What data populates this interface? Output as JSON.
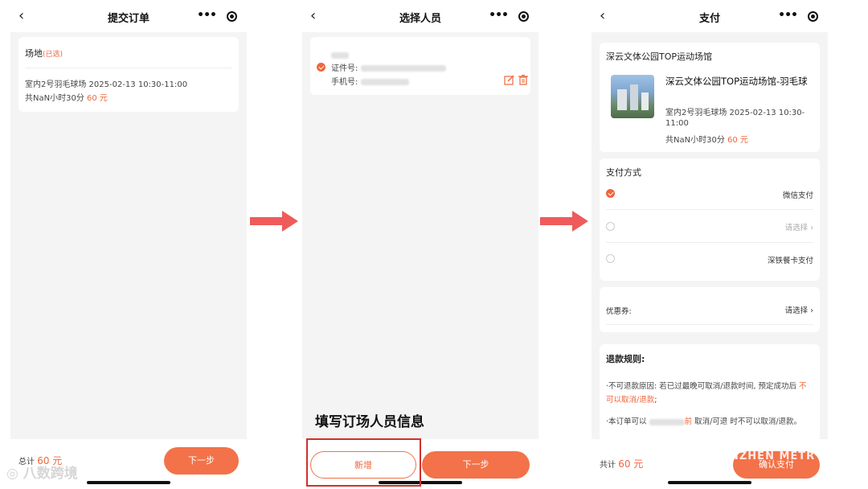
{
  "screen1": {
    "title": "提交订单",
    "venue_label": "场地",
    "venue_selected": "(已选)",
    "booking_line": "室内2号羽毛球场 2025-02-13 10:30-11:00",
    "duration_prefix": "共NaN小时30分",
    "duration_price": "60 元",
    "total_label": "总计",
    "total_price": "60 元",
    "next_button": "下一步"
  },
  "screen2": {
    "title": "选择人员",
    "person_name": "",
    "id_label": "证件号:",
    "phone_label": "手机号:",
    "caption": "填写订场人员信息",
    "add_button": "新增",
    "next_button": "下一步"
  },
  "screen3": {
    "title": "支付",
    "venue_name": "深云文体公园TOP运动场馆",
    "product_title": "深云文体公园TOP运动场馆-羽毛球",
    "product_line1": "室内2号羽毛球场 2025-02-13 10:30-",
    "product_line2": "11:00",
    "product_duration": "共NaN小时30分",
    "product_price": "60 元",
    "pay_method_title": "支付方式",
    "pay_wechat": "微信支付",
    "pay_select": "请选择",
    "pay_metro": "深铁餐卡支付",
    "coupon_label": "优惠券:",
    "coupon_value": "请选择",
    "refund_title": "退款规则:",
    "refund_p1_a": "·不可退款原因: 若已过最晚可取消/退款时间, 预定成功后",
    "refund_p1_b": "不可以取消/退款",
    "refund_p1_c": ";",
    "refund_p2_a": "·本订单可以",
    "refund_p2_b": "前",
    "refund_p2_c": "取消/可退",
    "refund_p2_d": "时不可以取消/退款。",
    "total_label": "共计",
    "total_price": "60 元",
    "confirm_button": "确认支付"
  },
  "watermarks": {
    "left": "八数跨境",
    "right": "NZHEN METR"
  },
  "colors": {
    "accent": "#f37249",
    "highlight_box": "#d0312d",
    "arrow": "#ef5a5a"
  },
  "icons": [
    "back-chevron-icon",
    "more-dots-icon",
    "target-icon",
    "check-circle-icon",
    "edit-icon",
    "trash-icon",
    "chevron-right-icon",
    "arrow-right-icon"
  ]
}
